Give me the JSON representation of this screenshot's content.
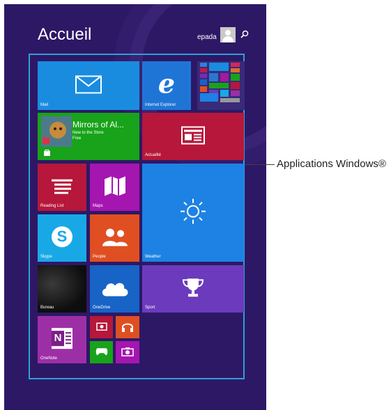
{
  "screen": {
    "title": "Accueil",
    "user_name": "epada"
  },
  "callout": {
    "label": "Applications Windows®"
  },
  "tiles": {
    "mail": {
      "label": "Mail",
      "color": "#1a8ce0"
    },
    "ie": {
      "label": "Internet Explorer",
      "color": "#1f75d6"
    },
    "store": {
      "title": "Mirrors of Al...",
      "line1": "New to the Store",
      "line2": "Free",
      "color": "#18a31a"
    },
    "actualite": {
      "label": "Actualité",
      "color": "#b6173a"
    },
    "reading_list": {
      "label": "Reading List",
      "color": "#b6173a"
    },
    "maps": {
      "label": "Maps",
      "color": "#a516b0"
    },
    "weather": {
      "label": "Weather",
      "color": "#1d82e3"
    },
    "skype": {
      "label": "Skype",
      "color": "#19a8e6"
    },
    "people": {
      "label": "People",
      "color": "#e04f21"
    },
    "bureau": {
      "label": "Bureau"
    },
    "onedrive": {
      "label": "OneDrive",
      "color": "#1863c6"
    },
    "sport": {
      "label": "Sport",
      "color": "#6c3bbd"
    },
    "onenote": {
      "label": "OneNote",
      "color": "#9d2fa6"
    }
  }
}
